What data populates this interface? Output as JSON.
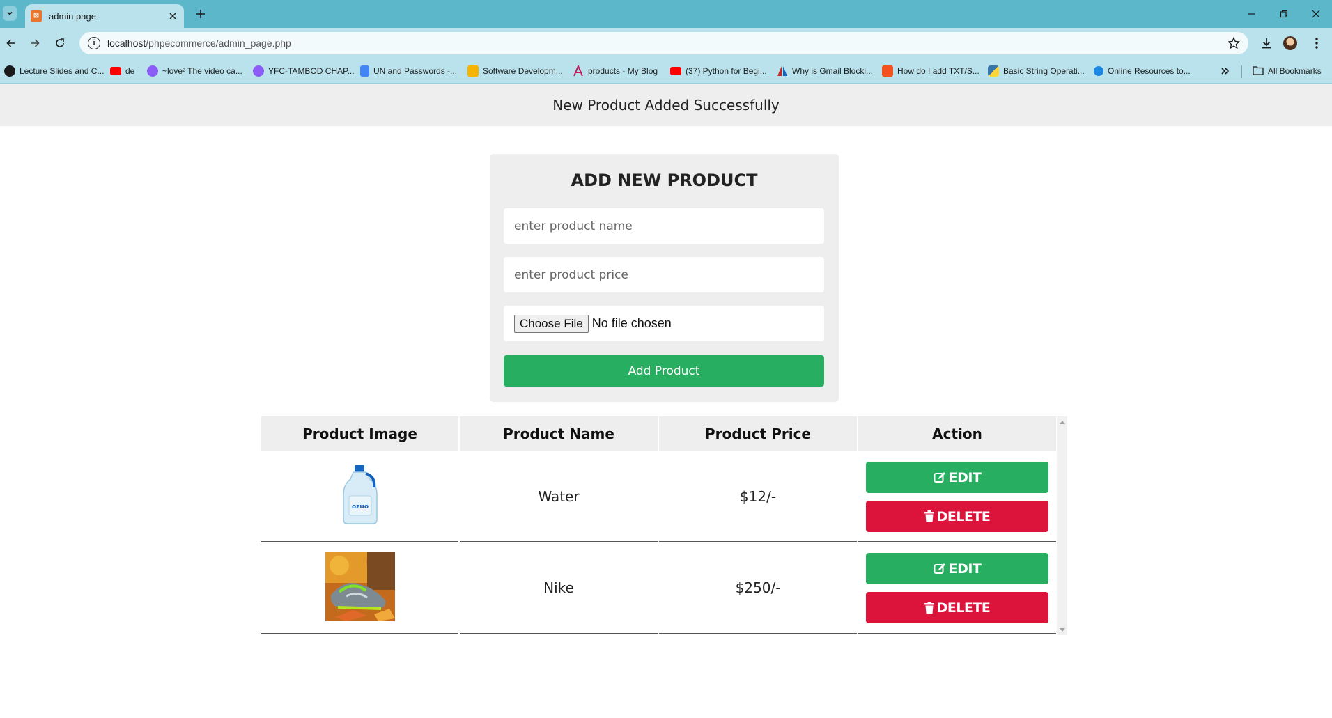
{
  "browser": {
    "tab_title": "admin page",
    "url_host": "localhost",
    "url_path": "/phpecommerce/admin_page.php",
    "bookmarks": [
      {
        "label": "Lecture Slides and C...",
        "icon": "lecture-icon",
        "color": "#1a1a1a"
      },
      {
        "label": "de",
        "icon": "youtube-icon",
        "color": "#ff0000"
      },
      {
        "label": "~love² The video ca...",
        "icon": "messenger-icon",
        "color": "#8b5cf6"
      },
      {
        "label": "YFC-TAMBOD CHAP...",
        "icon": "messenger-icon",
        "color": "#8b5cf6"
      },
      {
        "label": "UN and Passwords -...",
        "icon": "docs-icon",
        "color": "#4285f4"
      },
      {
        "label": "Software Developm...",
        "icon": "grid-icon",
        "color": "#f4b400"
      },
      {
        "label": "products - My Blog",
        "icon": "blog-icon",
        "color": "#c2185b"
      },
      {
        "label": "(37) Python for Begi...",
        "icon": "youtube-icon",
        "color": "#ff0000"
      },
      {
        "label": "Why is Gmail Blocki...",
        "icon": "adobe-icon",
        "color": "#c62828"
      },
      {
        "label": "How do I add TXT/S...",
        "icon": "site-icon",
        "color": "#f4511e"
      },
      {
        "label": "Basic String Operati...",
        "icon": "python-icon",
        "color": "#3776ab"
      },
      {
        "label": "Online Resources to...",
        "icon": "resource-icon",
        "color": "#1e88e5"
      }
    ],
    "all_bookmarks_label": "All Bookmarks"
  },
  "message": "New Product Added Successfully",
  "form": {
    "title": "ADD NEW PRODUCT",
    "name_placeholder": "enter product name",
    "price_placeholder": "enter product price",
    "file_button": "Choose File",
    "file_status": "No file chosen",
    "submit_label": "Add Product"
  },
  "table": {
    "headers": [
      "Product Image",
      "Product Name",
      "Product Price",
      "Action"
    ],
    "rows": [
      {
        "name": "Water",
        "price": "$12/-",
        "image": "water-bottle-image"
      },
      {
        "name": "Nike",
        "price": "$250/-",
        "image": "sneakers-image"
      }
    ],
    "edit_label": "EDIT",
    "delete_label": "DELETE"
  },
  "colors": {
    "green": "#27ae60",
    "red": "#dc143c",
    "panel": "#eeeeee",
    "chrome": "#5db7cb"
  }
}
